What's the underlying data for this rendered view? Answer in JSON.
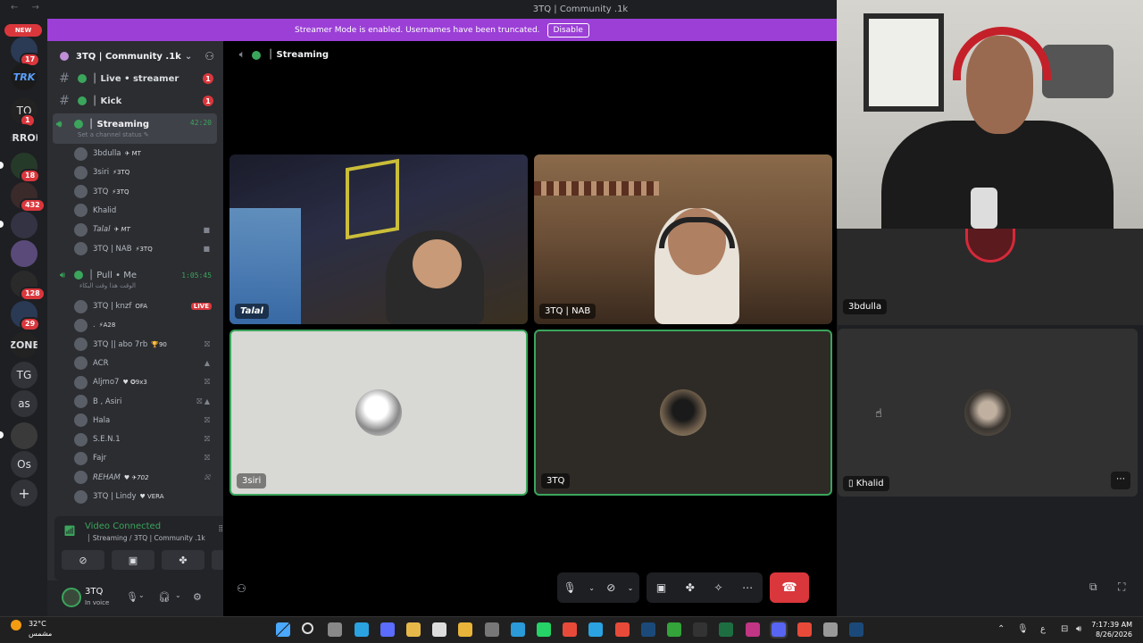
{
  "window": {
    "title": "3TQ | Community .1k",
    "nav": "← →"
  },
  "banner": {
    "text": "Streamer Mode is enabled. Usernames have been truncated.",
    "button": "Disable"
  },
  "rail": {
    "new_label": "NEW",
    "servers": [
      {
        "label": "",
        "badge": "17"
      },
      {
        "label": "TRK",
        "badge": ""
      },
      {
        "label": "TQ",
        "badge": "1"
      },
      {
        "label": "ERROR",
        "badge": ""
      },
      {
        "label": "",
        "badge": "18"
      },
      {
        "label": "",
        "badge": "432"
      },
      {
        "label": "",
        "badge": ""
      },
      {
        "label": "",
        "badge": ""
      },
      {
        "label": "",
        "badge": "128"
      },
      {
        "label": "",
        "badge": "29"
      },
      {
        "label": "ZONE",
        "badge": ""
      },
      {
        "label": "TG",
        "badge": ""
      },
      {
        "label": "as",
        "badge": ""
      },
      {
        "label": "",
        "badge": ""
      },
      {
        "label": "Os",
        "badge": ""
      },
      {
        "label": "+",
        "badge": ""
      }
    ]
  },
  "sidebar": {
    "guild_name": "3TQ | Community .1k",
    "text_channels": [
      {
        "name": "│ Live • streamer",
        "count": "1"
      },
      {
        "name": "│ Kick",
        "count": "1"
      }
    ],
    "active_voice": {
      "name": "│ Streaming",
      "time": "42:20",
      "status": "Set a channel status ✎"
    },
    "streaming_users": [
      {
        "name": "3bdulla",
        "tag": "✈ MT",
        "icon": ""
      },
      {
        "name": "3siri",
        "tag": "⚡3TQ",
        "icon": ""
      },
      {
        "name": "3TQ",
        "tag": "⚡3TQ",
        "icon": ""
      },
      {
        "name": "Khalid",
        "tag": "",
        "icon": ""
      },
      {
        "name": "Talal",
        "tag": "✈ MT",
        "icon": "■"
      },
      {
        "name": "3TQ | NAB",
        "tag": "⚡3TQ",
        "icon": "■"
      }
    ],
    "pull_voice": {
      "name": "│ Pull • Me",
      "time": "1:05:45",
      "status": "الوقت هذا وقت البكاء"
    },
    "pull_users": [
      {
        "name": "3TQ | knzf",
        "tag": "OFA",
        "live": "LIVE",
        "icon": ""
      },
      {
        "name": ".",
        "tag": "⚡A28",
        "live": "",
        "icon": ""
      },
      {
        "name": "3TQ || abo 7rb",
        "tag": "🏆90",
        "live": "",
        "icon": "⛝"
      },
      {
        "name": "ACR",
        "tag": "",
        "live": "",
        "icon": "▲"
      },
      {
        "name": "Aljmo7",
        "tag": "♥ ✪9x3",
        "live": "",
        "icon": "⛝"
      },
      {
        "name": "B , Asiri",
        "tag": "",
        "live": "",
        "icon": "⛝ ▲"
      },
      {
        "name": "Hala",
        "tag": "",
        "live": "",
        "icon": "⛝"
      },
      {
        "name": "S.E.N.1",
        "tag": "",
        "live": "",
        "icon": "⛝"
      },
      {
        "name": "Fajr",
        "tag": "",
        "live": "",
        "icon": "⛝"
      },
      {
        "name": "REHAM",
        "tag": "♥ ✈702",
        "live": "",
        "icon": "⛝"
      },
      {
        "name": "3TQ | Lindy",
        "tag": "♥ VERA",
        "live": "",
        "icon": ""
      }
    ]
  },
  "rtc": {
    "status": "Video Connected",
    "channel": "│ Streaming / 3TQ | Community .1k"
  },
  "userpanel": {
    "name": "3TQ",
    "status": "In voice"
  },
  "main": {
    "channel": "│ Streaming",
    "tiles": [
      {
        "name": "Talal",
        "type": "video"
      },
      {
        "name": "3TQ | NAB",
        "type": "video"
      },
      {
        "name": "3bdulla",
        "type": "video"
      },
      {
        "name": "3siri",
        "type": "avatar"
      },
      {
        "name": "3TQ",
        "type": "avatar"
      },
      {
        "name": "Khalid",
        "type": "avatar"
      }
    ]
  },
  "taskbar": {
    "weather_temp": "32°C",
    "weather_desc": "مشمس",
    "time": "7:17:39 AM",
    "date": "8/26/2026",
    "lang": "ع"
  },
  "colors": {
    "accent": "#5865f2",
    "green": "#3ba55c",
    "red": "#da373c",
    "banner": "#9b3fd6"
  }
}
